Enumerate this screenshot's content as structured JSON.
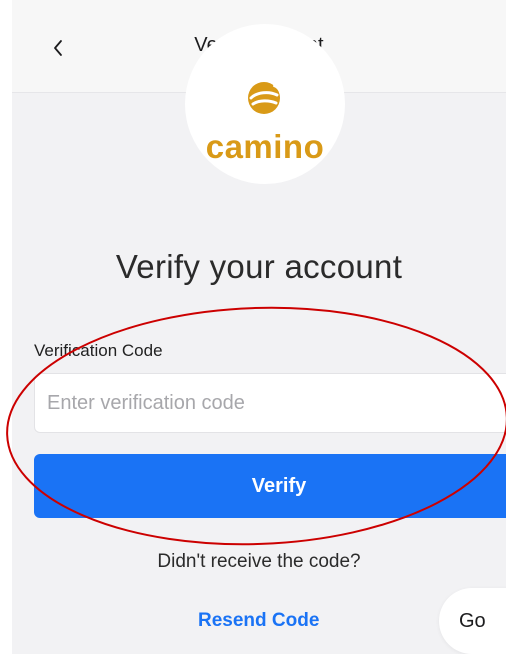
{
  "nav": {
    "title": "Verify Account",
    "back_icon": "chevron-left-icon"
  },
  "logo": {
    "icon": "camino-sun-icon",
    "text": "camino",
    "color": "#d99a17"
  },
  "heading": "Verify your account",
  "form": {
    "label": "Verification Code",
    "placeholder": "Enter verification code",
    "value": ""
  },
  "verify_button": {
    "label": "Verify",
    "color": "#1a73f5"
  },
  "resend": {
    "prompt": "Didn't receive the code?",
    "link_label": "Resend Code"
  },
  "keyboard": {
    "go_label": "Go"
  },
  "annotation": {
    "color": "#cc0000"
  }
}
